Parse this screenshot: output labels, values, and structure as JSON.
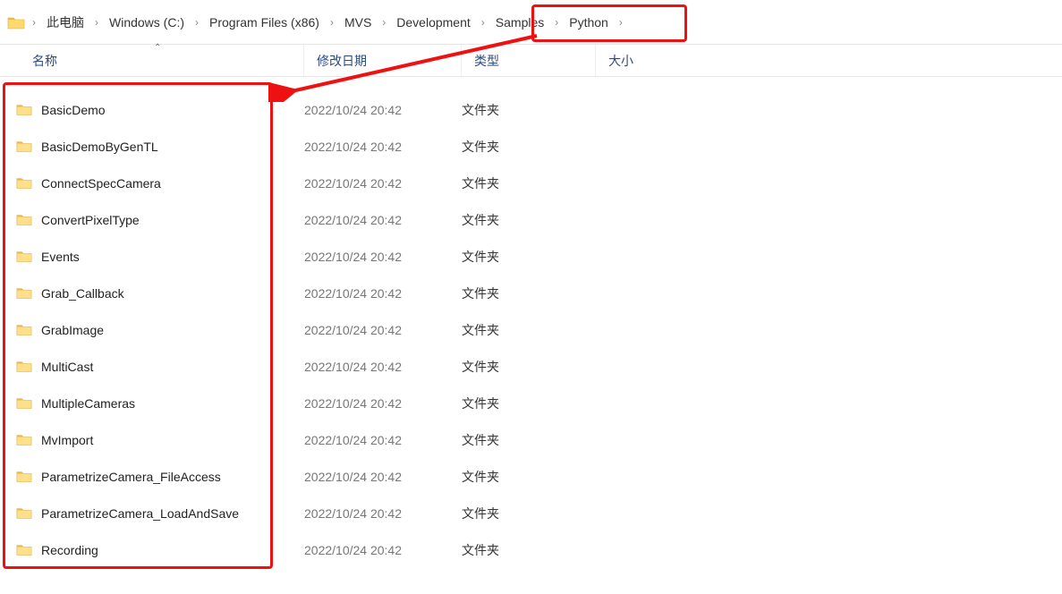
{
  "breadcrumb": [
    {
      "label": "此电脑",
      "is_root": false
    },
    {
      "label": "Windows (C:)",
      "is_root": false
    },
    {
      "label": "Program Files (x86)",
      "is_root": false
    },
    {
      "label": "MVS",
      "is_root": false
    },
    {
      "label": "Development",
      "is_root": false
    },
    {
      "label": "Samples",
      "is_root": false
    },
    {
      "label": "Python",
      "is_root": false
    }
  ],
  "columns": {
    "name": "名称",
    "date": "修改日期",
    "type": "类型",
    "size": "大小"
  },
  "type_folder_label": "文件夹",
  "items": [
    {
      "name": "BasicDemo",
      "date": "2022/10/24 20:42",
      "type": "文件夹",
      "size": ""
    },
    {
      "name": "BasicDemoByGenTL",
      "date": "2022/10/24 20:42",
      "type": "文件夹",
      "size": ""
    },
    {
      "name": "ConnectSpecCamera",
      "date": "2022/10/24 20:42",
      "type": "文件夹",
      "size": ""
    },
    {
      "name": "ConvertPixelType",
      "date": "2022/10/24 20:42",
      "type": "文件夹",
      "size": ""
    },
    {
      "name": "Events",
      "date": "2022/10/24 20:42",
      "type": "文件夹",
      "size": ""
    },
    {
      "name": "Grab_Callback",
      "date": "2022/10/24 20:42",
      "type": "文件夹",
      "size": ""
    },
    {
      "name": "GrabImage",
      "date": "2022/10/24 20:42",
      "type": "文件夹",
      "size": ""
    },
    {
      "name": "MultiCast",
      "date": "2022/10/24 20:42",
      "type": "文件夹",
      "size": ""
    },
    {
      "name": "MultipleCameras",
      "date": "2022/10/24 20:42",
      "type": "文件夹",
      "size": ""
    },
    {
      "name": "MvImport",
      "date": "2022/10/24 20:42",
      "type": "文件夹",
      "size": ""
    },
    {
      "name": "ParametrizeCamera_FileAccess",
      "date": "2022/10/24 20:42",
      "type": "文件夹",
      "size": ""
    },
    {
      "name": "ParametrizeCamera_LoadAndSave",
      "date": "2022/10/24 20:42",
      "type": "文件夹",
      "size": ""
    },
    {
      "name": "Recording",
      "date": "2022/10/24 20:42",
      "type": "文件夹",
      "size": ""
    }
  ]
}
